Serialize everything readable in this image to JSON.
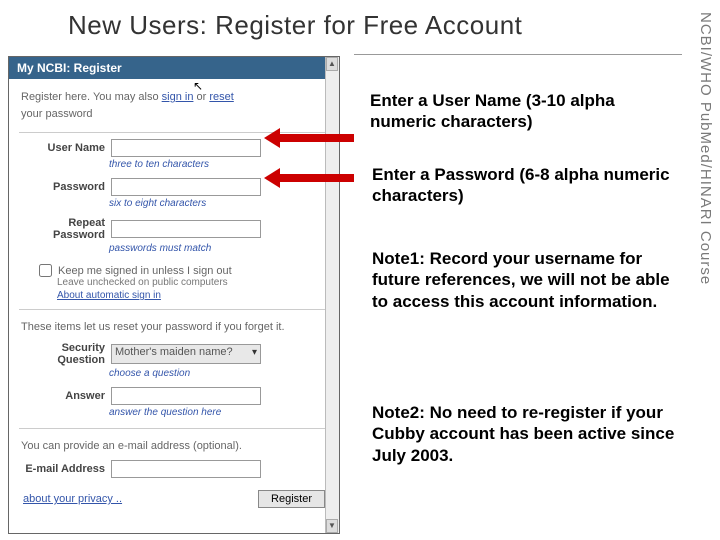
{
  "title": "New Users: Register for Free Account",
  "side_label": {
    "part1": "NCBI/WHO",
    "part2": " PubMed/HINARI Course"
  },
  "ncbi_header": "My NCBI: Register",
  "intro": {
    "pre": "Register here. You may also ",
    "signin": "sign in",
    "mid": " or ",
    "reset": "reset",
    "post": "your password"
  },
  "fields": {
    "username": {
      "label": "User Name",
      "hint": "three to ten characters"
    },
    "password": {
      "label": "Password",
      "hint": "six to eight characters"
    },
    "repeat": {
      "label": "Repeat Password",
      "hint": "passwords must match"
    }
  },
  "keep_signed": {
    "label": "Keep me signed in unless I sign out",
    "sub": "Leave unchecked on public computers",
    "link": "About automatic sign in"
  },
  "reset_para": "These items let us reset your password if you forget it.",
  "security": {
    "label": "Security Question",
    "value": "Mother's maiden name?",
    "hint": "choose a question"
  },
  "answer": {
    "label": "Answer",
    "hint": "answer the question here"
  },
  "optional_para": "You can provide an e-mail address (optional).",
  "email": {
    "label": "E-mail Address"
  },
  "privacy": "about your privacy ..",
  "register_btn": "Register",
  "annotations": {
    "a1": "Enter a User Name (3-10 alpha numeric characters)",
    "a2": "Enter a Password (6-8 alpha numeric characters)",
    "n1": "Note1: Record your username for future references, we will not be able to access this account information.",
    "n2": "Note2: No need to re-register if your Cubby account has been active since July 2003."
  }
}
